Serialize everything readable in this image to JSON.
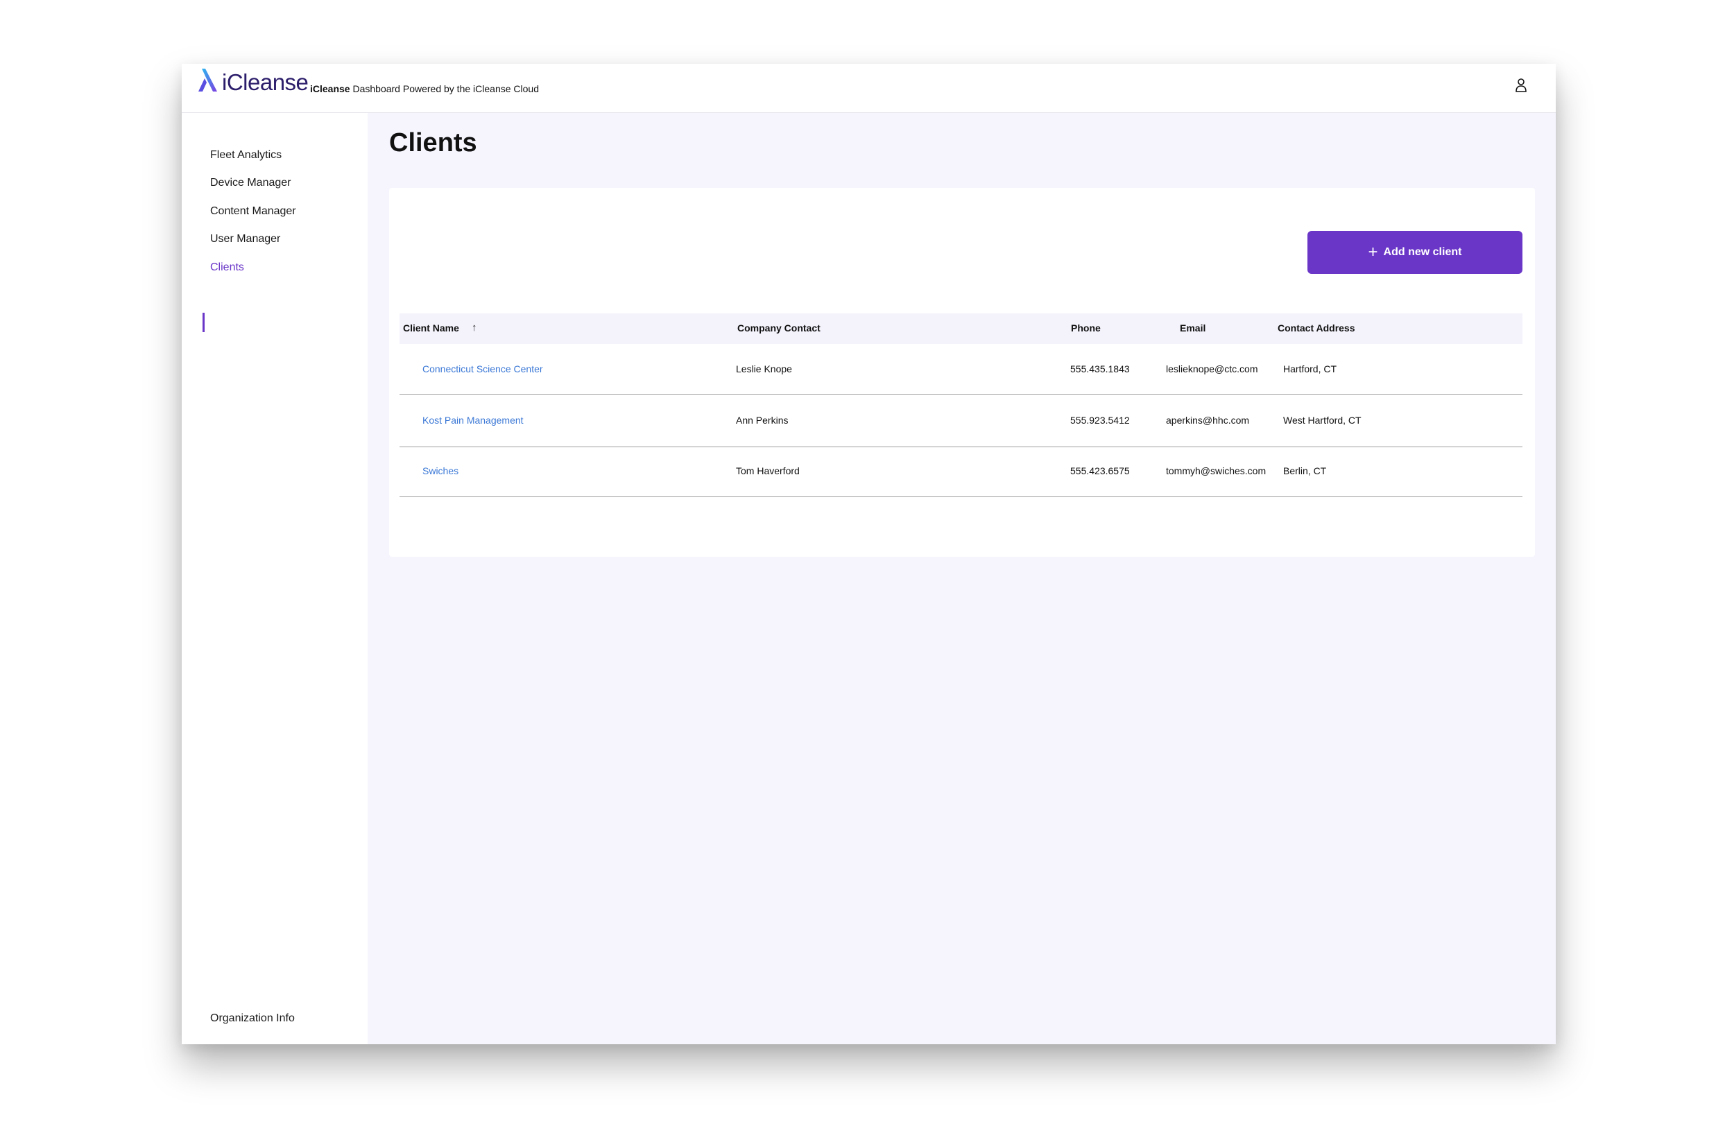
{
  "header": {
    "logo_text": "iCleanse",
    "tagline_brand": "iCleanse",
    "tagline_rest": " Dashboard Powered by the iCleanse Cloud"
  },
  "sidebar": {
    "items": [
      {
        "label": "Fleet Analytics"
      },
      {
        "label": "Device Manager"
      },
      {
        "label": "Content Manager"
      },
      {
        "label": "User Manager"
      },
      {
        "label": "Clients",
        "active": true
      }
    ],
    "footer_label": "Organization Info"
  },
  "main": {
    "title": "Clients",
    "add_button_label": "Add new client",
    "table": {
      "columns": [
        "Client Name",
        "Company Contact",
        "Phone",
        "Email",
        "Contact Address"
      ],
      "sort_column": "Client Name",
      "sort_direction": "ascending",
      "rows": [
        [
          "Connecticut Science Center",
          "Leslie Knope",
          "555.435.1843",
          "leslieknope@ctc.com",
          "Hartford, CT"
        ],
        [
          "Kost Pain Management",
          "Ann Perkins",
          "555.923.5412",
          "aperkins@hhc.com",
          "West Hartford, CT"
        ],
        [
          "Swiches",
          "Tom Haverford",
          "555.423.6575",
          "tommyh@swiches.com",
          "Berlin, CT"
        ]
      ]
    }
  },
  "colors": {
    "accent": "#6a36c8",
    "link": "#3b78d6",
    "main_background": "#f6f4fd",
    "logo_text": "#2d1e6b"
  },
  "icons": {
    "logo": "icleanse-logo-icon",
    "user": "user-icon",
    "sort": "arrow-up-icon",
    "add": "plus-icon"
  }
}
